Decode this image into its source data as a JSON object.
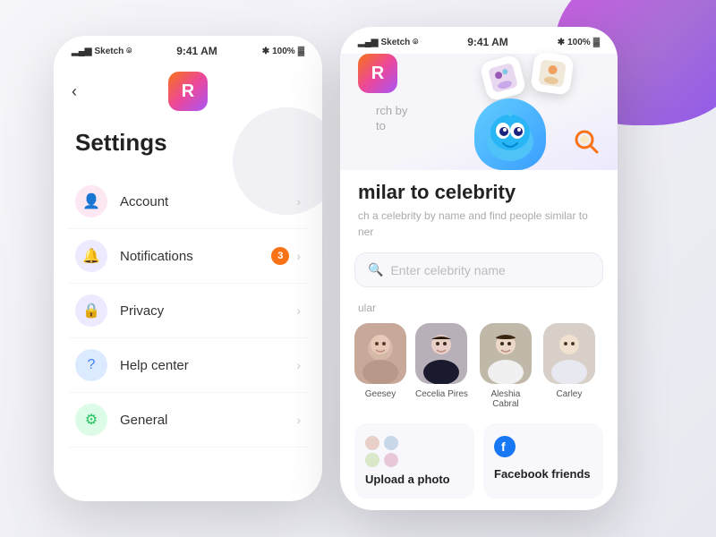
{
  "app": {
    "icon_letter": "R"
  },
  "background": {
    "color": "#f0f0f5"
  },
  "left_phone": {
    "status_bar": {
      "carrier": "Sketch",
      "time": "9:41 AM",
      "battery": "100%"
    },
    "back_label": "‹",
    "title": "Settings",
    "items": [
      {
        "id": "account",
        "label": "Account",
        "icon": "👤",
        "icon_class": "icon-account",
        "badge": null
      },
      {
        "id": "notifications",
        "label": "Notifications",
        "icon": "🔔",
        "icon_class": "icon-notif",
        "badge": "3"
      },
      {
        "id": "privacy",
        "label": "Privacy",
        "icon": "🔒",
        "icon_class": "icon-privacy",
        "badge": null
      },
      {
        "id": "help",
        "label": "Help center",
        "icon": "❓",
        "icon_class": "icon-help",
        "badge": null
      },
      {
        "id": "general",
        "label": "General",
        "icon": "⚙️",
        "icon_class": "icon-general",
        "badge": null
      }
    ]
  },
  "right_phone": {
    "status_bar": {
      "carrier": "Sketch",
      "time": "9:41 AM",
      "battery": "100%"
    },
    "search_by_label": "rch by",
    "search_by_label2": "to",
    "section_title": "milar to celebrity",
    "section_subtitle": "ch a celebrity by name and find people similar to\nner",
    "search_placeholder": "Enter celebrity name",
    "popular_label": "ular",
    "celebrities": [
      {
        "name": "Geesey",
        "color": "#d4a0a0"
      },
      {
        "name": "Cecelia Pires",
        "color": "#c8b8c0"
      },
      {
        "name": "Aleshia Cabral",
        "color": "#c0b8b0"
      },
      {
        "name": "Carley",
        "color": "#d8d0c8"
      }
    ],
    "bottom_cards": [
      {
        "id": "upload",
        "title": "Upload a\nphoto"
      },
      {
        "id": "facebook",
        "title": "Facebook\nfriends"
      }
    ]
  },
  "icons": {
    "back": "‹",
    "chevron": "›",
    "search": "🔍",
    "bluetooth": "⚡",
    "signal": "📶",
    "wifi": "WiFi",
    "battery_full": "🔋"
  }
}
